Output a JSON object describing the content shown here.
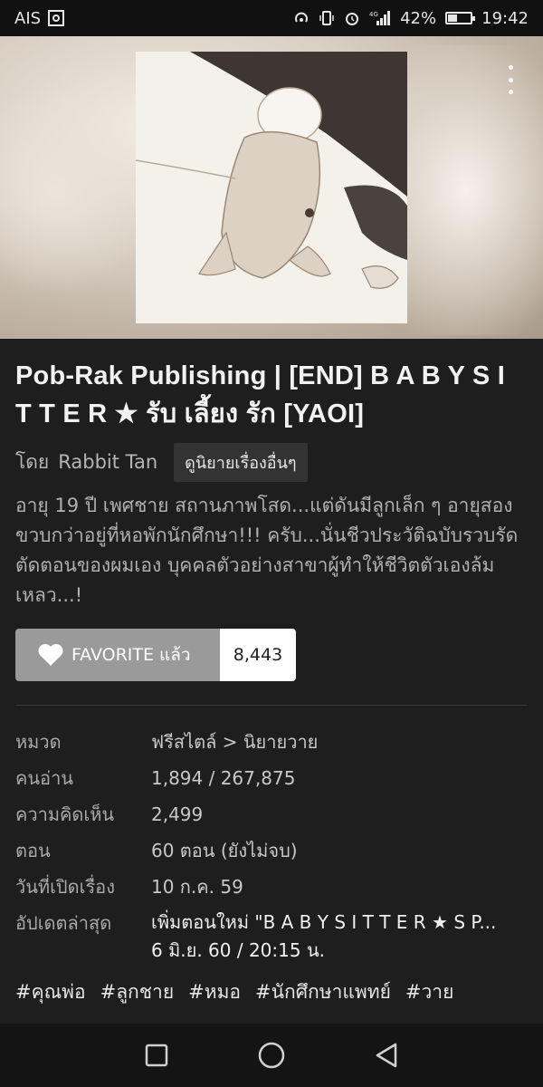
{
  "status_bar": {
    "carrier": "AIS",
    "battery_percent": "42%",
    "battery_level": 0.42,
    "time": "19:42",
    "network": "4G"
  },
  "cover": {
    "more_icon": "more-vertical-icon"
  },
  "novel": {
    "title": "Pob-Rak Publishing | [END] B A B Y S I T T E R ★ รับ เลี้ยง รัก [YAOI]",
    "by_label": "โดย",
    "author": "Rabbit Tan",
    "other_works_label": "ดูนิยายเรื่องอื่นๆ",
    "synopsis": "อายุ 19 ปี เพศชาย สถานภาพโสด...แต่ดันมีลูกเล็ก ๆ อายุสองขวบกว่าอยู่ที่หอพักนักศึกษา!!! ครับ...นั่นชีวประวัติฉบับรวบรัดตัดตอนของผมเอง บุคคลตัวอย่างสาขาผู้ทำให้ชีวิตตัวเองล้มเหลว...!"
  },
  "favorite": {
    "label": "FAVORITE แล้ว",
    "count": "8,443"
  },
  "info": {
    "category_label": "หมวด",
    "category_value": "ฟรีสไตล์ > นิยายวาย",
    "readers_label": "คนอ่าน",
    "readers_value": "1,894 / 267,875",
    "comments_label": "ความคิดเห็น",
    "comments_value": "2,499",
    "chapters_label": "ตอน",
    "chapters_value": "60 ตอน (ยังไม่จบ)",
    "opened_label": "วันที่เปิดเรื่อง",
    "opened_value": "10 ก.ค. 59",
    "updated_label": "อัปเดตล่าสุด",
    "updated_line1": "เพิ่มตอนใหม่ \"B A B Y S I T T E R ★ S P...",
    "updated_line2": "6 มิ.ย. 60 / 20:15 น."
  },
  "tags": [
    "#คุณพ่อ",
    "#ลูกชาย",
    "#หมอ",
    "#นักศึกษาแพทย์",
    "#วาย"
  ],
  "nav": {
    "recents_icon": "square-icon",
    "home_icon": "circle-icon",
    "back_icon": "triangle-back-icon"
  }
}
